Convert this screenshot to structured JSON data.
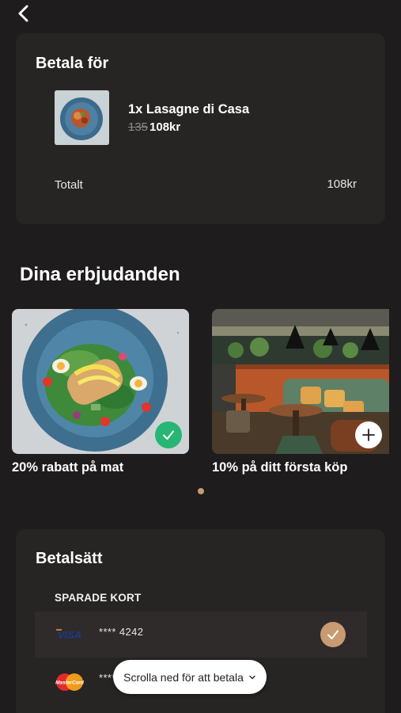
{
  "nav": {
    "back_icon": "chevron-left-icon"
  },
  "payment": {
    "title": "Betala för",
    "item": {
      "name": "1x Lasagne di Casa",
      "old_price": "135",
      "price": "108kr"
    },
    "total_label": "Totalt",
    "total_value": "108kr"
  },
  "offers": {
    "title": "Dina erbjudanden",
    "items": [
      {
        "label": "20% rabatt på mat",
        "selected": true,
        "badge_icon": "check-icon"
      },
      {
        "label": "10% på ditt första köp",
        "selected": false,
        "badge_icon": "plus-icon"
      }
    ],
    "page_indicator": {
      "count": 1,
      "active": 1
    }
  },
  "methods": {
    "title": "Betalsätt",
    "saved_label": "SPARADE KORT",
    "cards": [
      {
        "brand": "VISA",
        "masked": "**** 4242",
        "selected": true
      },
      {
        "brand": "MasterCard",
        "masked": "****",
        "selected": false
      }
    ]
  },
  "scroll_hint": {
    "label": "Scrolla ned för att betala",
    "icon": "chevron-down-icon"
  },
  "colors": {
    "background": "#1e1c1c",
    "card": "#272424",
    "accent": "#c99b72",
    "success": "#27b673"
  }
}
